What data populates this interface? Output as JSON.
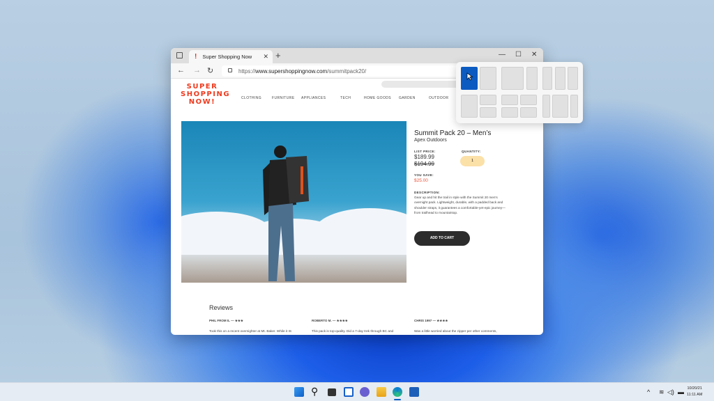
{
  "browser": {
    "tab_title": "Super Shopping Now",
    "url_prefix": "https://",
    "url_domain": "www.supershoppingnow.com",
    "url_path": "/summitpack20/"
  },
  "site": {
    "logo": "SUPER SHOPPING NOW!",
    "menu": [
      "CLOTHING",
      "FURNITURE",
      "APPLIANCES",
      "TECH",
      "HOME GOODS",
      "GARDEN",
      "OUTDOOR"
    ]
  },
  "product": {
    "title": "Summit Pack 20 – Men’s",
    "brand": "Apex Outdoors",
    "list_price_label": "LIST PRICE:",
    "price": "$189.99",
    "old_price": "$194.99",
    "quantity_label": "QUANTITY:",
    "quantity": "1",
    "save_label": "YOU SAVE:",
    "save": "$25.00",
    "description_label": "DESCRIPTION:",
    "description": "Gear up and hit the trail in style with the Summit 20 men's overnight pack. Lightweight, durable, with a padded back and shoulder straps, it guarantees a comfortable-yet-epic journey—from trailhead to mountaintop.",
    "add_to_cart": "ADD TO CART"
  },
  "reviews": {
    "title": "Reviews",
    "items": [
      {
        "name": "PHIL FROM IL — ★★★",
        "text": "Took this on a recent overnighter at Mt. Baker. While it IS"
      },
      {
        "name": "ROBERTO M. — ★★★★",
        "text": "This pack is top-quality. Did a 7-day trek through BC and"
      },
      {
        "name": "CHRIS 1997 — ★★★★",
        "text": "Was a little worried about the zipper per other comments,"
      }
    ]
  },
  "taskbar": {
    "date": "10/20/21",
    "time": "11:11 AM"
  },
  "colors": {
    "accent": "#0c5bc0",
    "logo": "#f03a1e",
    "sale": "#f0553a"
  }
}
